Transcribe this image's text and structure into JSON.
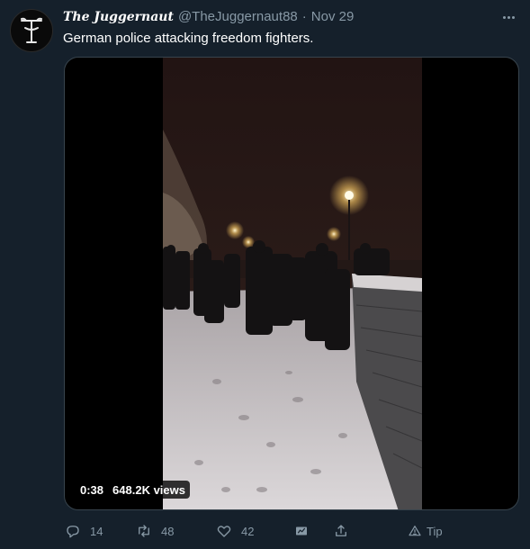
{
  "tweet": {
    "author_name": "The Juggernaut",
    "handle": "@TheJuggernaut88",
    "separator": "·",
    "date": "Nov 29",
    "text": "German police attacking freedom fighters.",
    "more_icon": "more-horizontal-icon"
  },
  "media": {
    "duration": "0:38",
    "views": "648.2K views"
  },
  "actions": {
    "replies": "14",
    "retweets": "48",
    "likes": "42",
    "tip_label": "Tip",
    "icons": [
      "reply-icon",
      "retweet-icon",
      "like-icon",
      "analytics-icon",
      "share-icon",
      "tip-icon"
    ]
  },
  "colors": {
    "background": "#15202b",
    "secondary_text": "#8899a6",
    "border": "#38444d"
  }
}
